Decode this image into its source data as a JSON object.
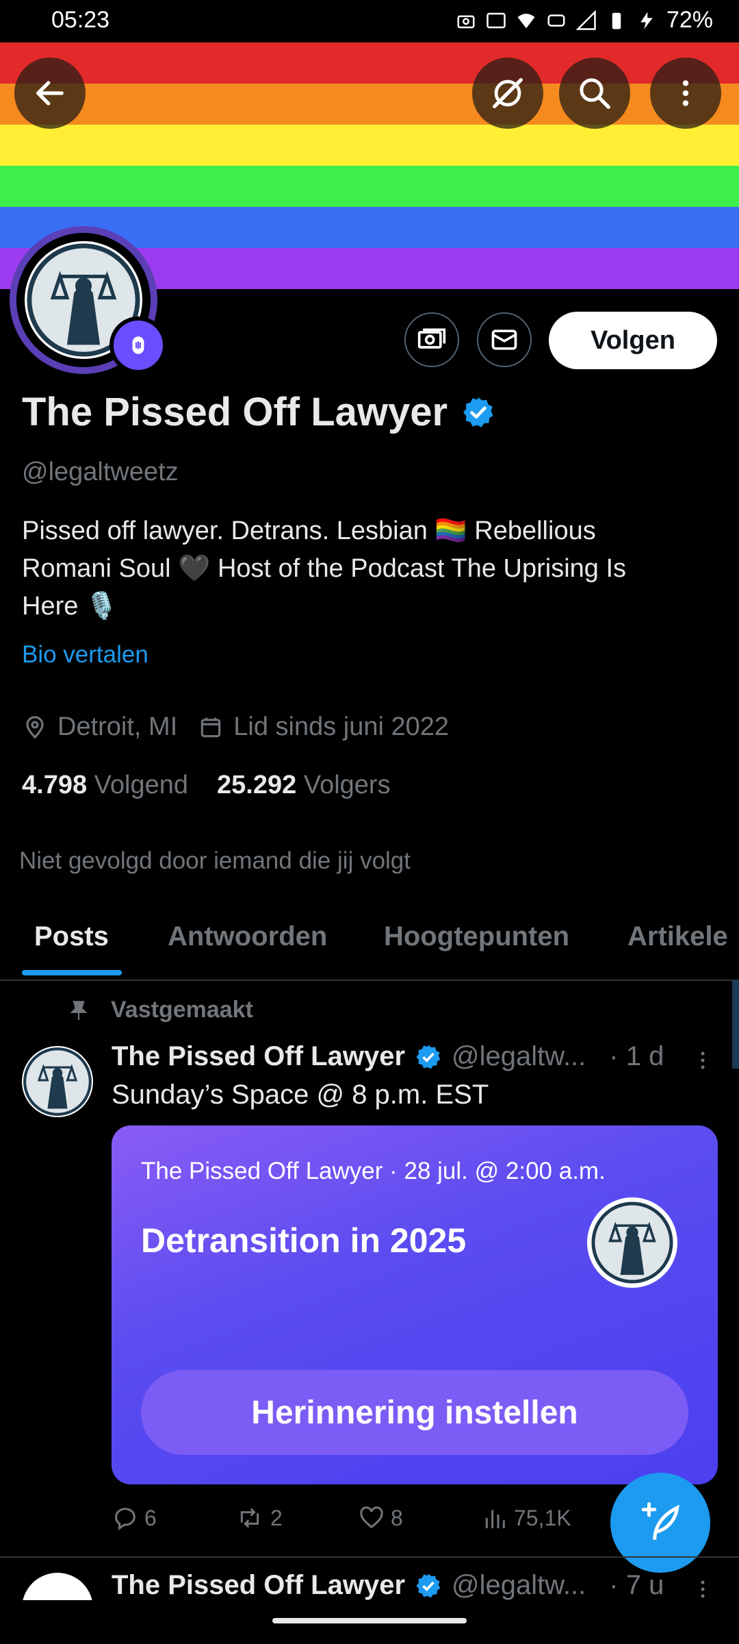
{
  "status_bar": {
    "time": "05:23",
    "battery": "72%"
  },
  "banner": {
    "colors": [
      "#e22a2a",
      "#f58a1f",
      "#ffee33",
      "#3ef04b",
      "#3a6ff5",
      "#9c3cf0"
    ]
  },
  "profile": {
    "name": "The Pissed Off Lawyer",
    "handle": "@legaltweetz",
    "bio_line1": "Pissed off lawyer. Detrans. Lesbian 🏳️‍🌈 Rebellious",
    "bio_line2": "Romani Soul 🖤 Host of the Podcast The Uprising Is",
    "bio_line3": "Here 🎙️",
    "translate_bio": "Bio vertalen",
    "location": "Detroit, MI",
    "joined": "Lid sinds juni 2022",
    "following_count": "4.798",
    "following_label": "Volgend",
    "followers_count": "25.292",
    "followers_label": "Volgers",
    "not_followed": "Niet gevolgd door iemand die jij volgt",
    "follow_label": "Volgen"
  },
  "tabs": [
    "Posts",
    "Antwoorden",
    "Hoogtepunten",
    "Artikele"
  ],
  "pinned_post": {
    "pinned_label": "Vastgemaakt",
    "author": "The Pissed Off Lawyer",
    "handle": "@legaltw...",
    "time": "· 1 d",
    "text": "Sunday’s Space @ 8 p.m. EST",
    "space": {
      "meta": "The Pissed Off Lawyer · 28 jul. @ 2:00 a.m.",
      "title": "Detransition in 2025",
      "reminder": "Herinnering instellen"
    },
    "replies": "6",
    "reposts": "2",
    "likes": "8",
    "views": "75,1K"
  },
  "next_post": {
    "author": "The Pissed Off Lawyer",
    "handle": "@legaltw...",
    "time": "· 7 u"
  }
}
